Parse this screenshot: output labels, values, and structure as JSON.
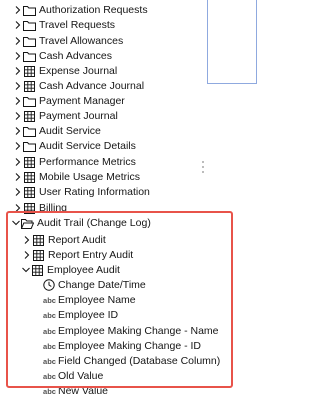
{
  "items": [
    {
      "label": "Authorization Requests",
      "icon": "folder-icon",
      "expanded": false
    },
    {
      "label": "Travel Requests",
      "icon": "folder-icon",
      "expanded": false
    },
    {
      "label": "Travel Allowances",
      "icon": "folder-icon",
      "expanded": false
    },
    {
      "label": "Cash Advances",
      "icon": "folder-icon",
      "expanded": false
    },
    {
      "label": "Expense Journal",
      "icon": "table-icon",
      "expanded": false
    },
    {
      "label": "Cash Advance Journal",
      "icon": "table-icon",
      "expanded": false
    },
    {
      "label": "Payment Manager",
      "icon": "folder-icon",
      "expanded": false
    },
    {
      "label": "Payment Journal",
      "icon": "table-icon",
      "expanded": false
    },
    {
      "label": "Audit Service",
      "icon": "folder-icon",
      "expanded": false
    },
    {
      "label": "Audit Service Details",
      "icon": "folder-icon",
      "expanded": false
    },
    {
      "label": "Performance Metrics",
      "icon": "table-icon",
      "expanded": false
    },
    {
      "label": "Mobile Usage Metrics",
      "icon": "table-icon",
      "expanded": false
    },
    {
      "label": "User Rating Information",
      "icon": "table-icon",
      "expanded": false
    },
    {
      "label": "Billing",
      "icon": "table-icon",
      "expanded": false
    },
    {
      "label": "Audit Trail (Change Log)",
      "icon": "folder-open-icon",
      "expanded": true
    },
    {
      "label": "Report Audit",
      "icon": "table-icon",
      "expanded": false
    },
    {
      "label": "Report Entry Audit",
      "icon": "table-icon",
      "expanded": false
    },
    {
      "label": "Employee Audit",
      "icon": "table-icon",
      "expanded": true
    },
    {
      "label": "Change Date/Time",
      "icon": "clock-icon",
      "abc": ""
    },
    {
      "label": "Employee Name",
      "icon": "abc-icon",
      "abc": "abc"
    },
    {
      "label": "Employee ID",
      "icon": "abc-icon",
      "abc": "abc"
    },
    {
      "label": "Employee Making Change - Name",
      "icon": "abc-icon",
      "abc": "abc"
    },
    {
      "label": "Employee Making Change - ID",
      "icon": "abc-icon",
      "abc": "abc"
    },
    {
      "label": "Field Changed (Database Column)",
      "icon": "abc-icon",
      "abc": "abc"
    },
    {
      "label": "Old Value",
      "icon": "abc-icon",
      "abc": "abc"
    },
    {
      "label": "New Value",
      "icon": "abc-icon",
      "abc": "abc"
    }
  ],
  "colors": {
    "highlight": "#e8534a",
    "panel_border": "#8fa9df"
  }
}
